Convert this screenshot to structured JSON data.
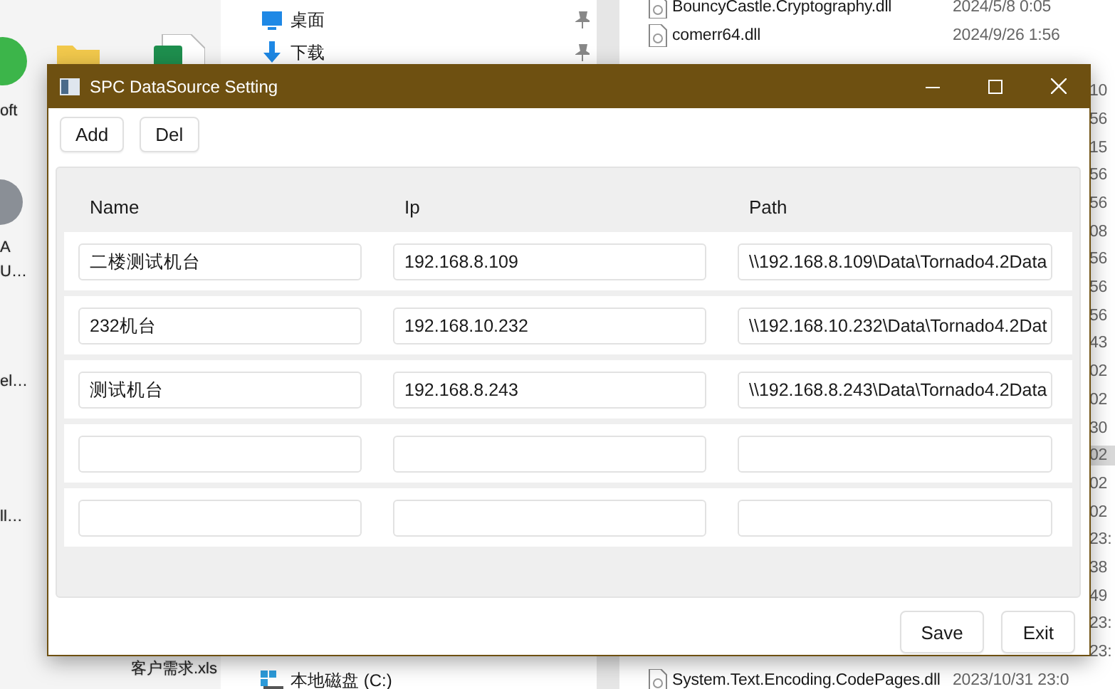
{
  "desktop": {
    "icon_labels": [
      "oft",
      "A",
      "U…",
      "el…",
      "ll…",
      "客户需求.xls"
    ]
  },
  "explorer": {
    "nav_items": [
      {
        "label": "桌面",
        "kind": "desktop",
        "pinned": true
      },
      {
        "label": "下载",
        "kind": "download",
        "pinned": true
      },
      {
        "label": "本地磁盘 (C:)",
        "kind": "drive",
        "pinned": false
      }
    ],
    "file_rows": [
      {
        "name": "BouncyCastle.Cryptography.dll",
        "date": "2024/5/8 0:05"
      },
      {
        "name": "comerr64.dll",
        "date": "2024/9/26 1:56"
      },
      {},
      {
        "date_fragment": "10"
      },
      {
        "date_fragment": "56"
      },
      {
        "date_fragment": "15"
      },
      {
        "date_fragment": "56"
      },
      {
        "date_fragment": "56"
      },
      {
        "date_fragment": "08"
      },
      {
        "date_fragment": "56"
      },
      {
        "date_fragment": "56"
      },
      {
        "date_fragment": "56"
      },
      {
        "date_fragment": "43"
      },
      {
        "date_fragment": "02"
      },
      {
        "date_fragment": "02"
      },
      {
        "date_fragment": "30"
      },
      {
        "date_fragment": "02",
        "selected": true
      },
      {
        "date_fragment": "02"
      },
      {
        "date_fragment": "02"
      },
      {
        "date_fragment": "23:"
      },
      {
        "date_fragment": "38"
      },
      {
        "date_fragment": "49"
      },
      {
        "date_fragment": "23:"
      },
      {
        "date_fragment": "23:"
      },
      {
        "name": "System.Text.Encoding.CodePages.dll",
        "date": "2023/10/31 23:0"
      }
    ]
  },
  "dialog": {
    "title": "SPC DataSource Setting",
    "toolbar": [
      "Add",
      "Del"
    ],
    "columns": [
      "Name",
      "Ip",
      "Path"
    ],
    "rows": [
      {
        "name": "二楼测试机台",
        "ip": "192.168.8.109",
        "path": "\\\\192.168.8.109\\Data\\Tornado4.2Data"
      },
      {
        "name": "232机台",
        "ip": "192.168.10.232",
        "path": "\\\\192.168.10.232\\Data\\Tornado4.2Dat"
      },
      {
        "name": "测试机台",
        "ip": "192.168.8.243",
        "path": "\\\\192.168.8.243\\Data\\Tornado4.2Data"
      },
      {},
      {}
    ],
    "buttons": [
      "Save",
      "Exit"
    ]
  }
}
